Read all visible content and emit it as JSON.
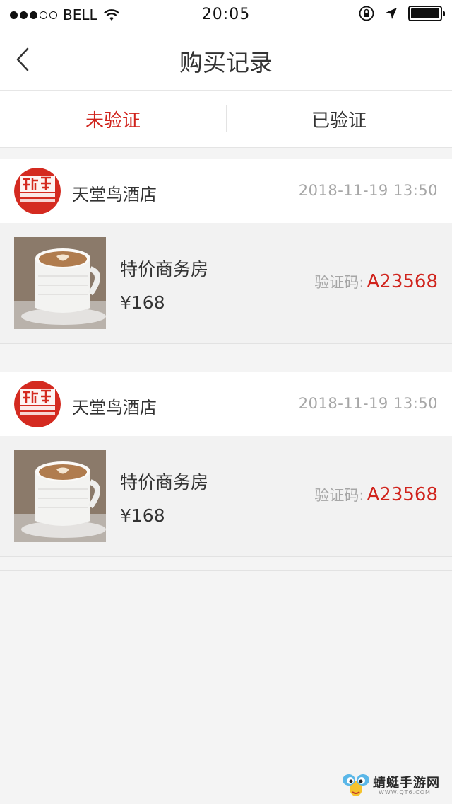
{
  "status_bar": {
    "carrier": "BELL",
    "time": "20:05",
    "signal_bars": 3,
    "signal_total": 5,
    "battery_level": 1.0
  },
  "navbar": {
    "back_icon": "chevron-left-icon",
    "title": "购买记录"
  },
  "tabs": [
    {
      "label": "未验证",
      "active": true
    },
    {
      "label": "已验证",
      "active": false
    }
  ],
  "orders": [
    {
      "store_name": "天堂鸟酒店",
      "order_time": "2018-11-19 13:50",
      "product_name": "特价商务房",
      "price": "¥168",
      "verify_label": "验证码:",
      "verify_code": "A23568"
    },
    {
      "store_name": "天堂鸟酒店",
      "order_time": "2018-11-19 13:50",
      "product_name": "特价商务房",
      "price": "¥168",
      "verify_label": "验证码:",
      "verify_code": "A23568"
    }
  ],
  "watermark": {
    "text": "蜻蜓手游网",
    "url": "WWW.QT6.COM"
  },
  "colors": {
    "accent": "#d0231c",
    "muted": "#a6a6a6",
    "background": "#f4f4f4"
  }
}
